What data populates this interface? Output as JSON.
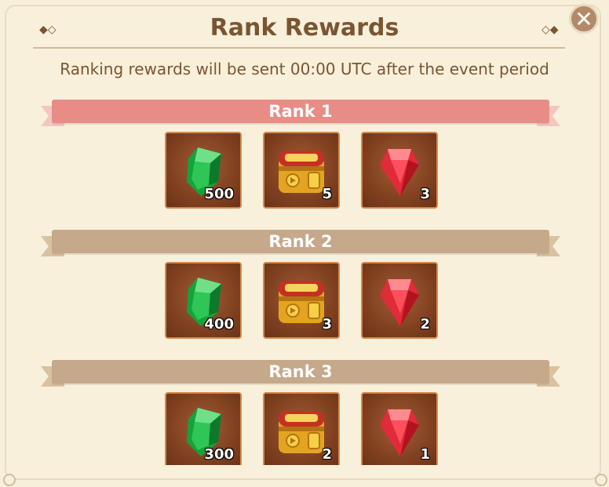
{
  "header": {
    "title": "Rank Rewards",
    "subtitle": "Ranking rewards will be sent 00:00 UTC after the event period",
    "close_icon": "close-icon"
  },
  "ranks": [
    {
      "label": "Rank 1",
      "rewards": [
        {
          "name": "emerald",
          "count": "500"
        },
        {
          "name": "treasure-chest",
          "count": "5"
        },
        {
          "name": "ruby",
          "count": "3"
        }
      ]
    },
    {
      "label": "Rank 2",
      "rewards": [
        {
          "name": "emerald",
          "count": "400"
        },
        {
          "name": "treasure-chest",
          "count": "3"
        },
        {
          "name": "ruby",
          "count": "2"
        }
      ]
    },
    {
      "label": "Rank 3",
      "rewards": [
        {
          "name": "emerald",
          "count": "300"
        },
        {
          "name": "treasure-chest",
          "count": "2"
        },
        {
          "name": "ruby",
          "count": "1"
        }
      ]
    }
  ],
  "colors": {
    "background": "#f8f0da",
    "text": "#7a5533",
    "rank1_ribbon": "#e88d85",
    "rank_ribbon": "#c6a88a",
    "item_border": "#d4894d"
  }
}
